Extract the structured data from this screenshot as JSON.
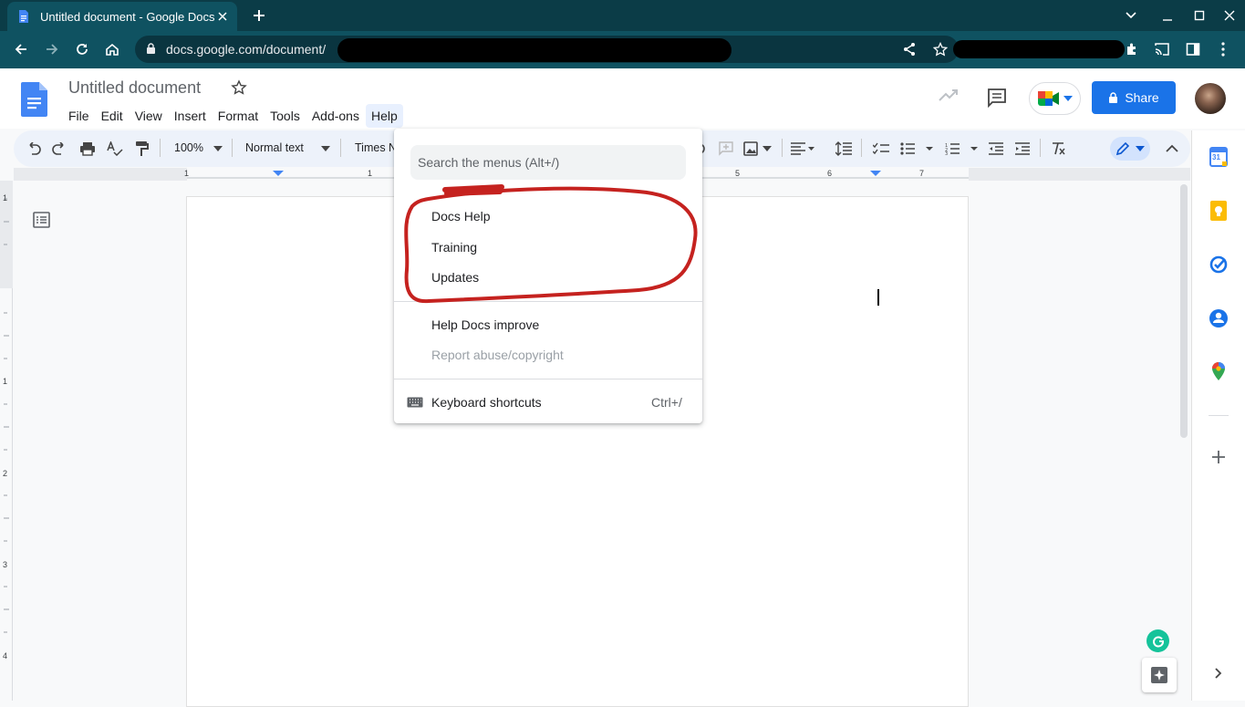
{
  "browser": {
    "tab_title": "Untitled document - Google Docs",
    "url": "docs.google.com/document/"
  },
  "docs": {
    "title": "Untitled document",
    "menus": [
      "File",
      "Edit",
      "View",
      "Insert",
      "Format",
      "Tools",
      "Add-ons",
      "Help"
    ],
    "share_label": "Share",
    "zoom": "100%",
    "style": "Normal text",
    "font": "Times N"
  },
  "ruler": {
    "h_numbers": [
      "1",
      "1",
      "5",
      "6",
      "7"
    ],
    "v_numbers": [
      "1",
      "1",
      "2",
      "3",
      "4"
    ]
  },
  "help_menu": {
    "search_placeholder": "Search the menus (Alt+/)",
    "items": [
      "Docs Help",
      "Training",
      "Updates"
    ],
    "improve": "Help Docs improve",
    "report": "Report abuse/copyright",
    "shortcuts": "Keyboard shortcuts",
    "shortcuts_key": "Ctrl+/"
  },
  "side_panel": {
    "calendar_day": "31"
  },
  "colors": {
    "accent": "#1a73e8",
    "annotation": "#c5221f",
    "chrome": "#0f5261"
  }
}
